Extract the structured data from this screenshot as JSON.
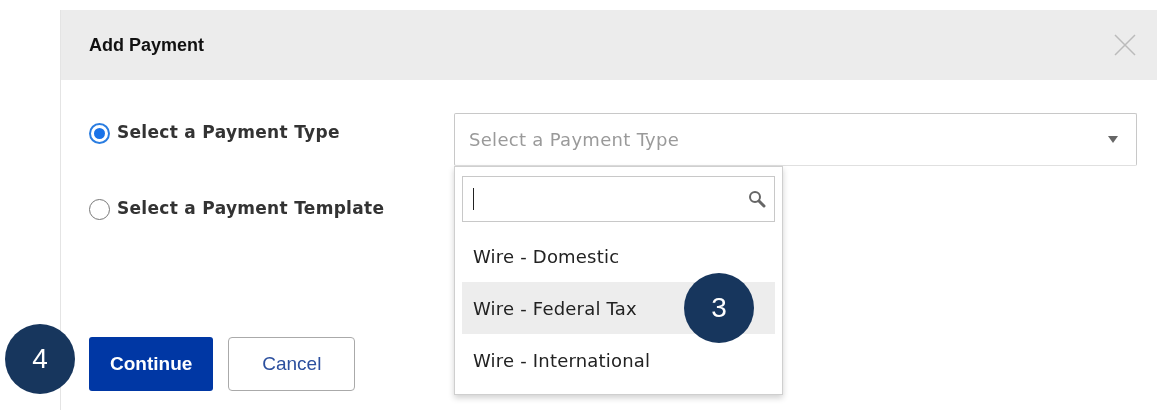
{
  "dialog": {
    "title": "Add Payment"
  },
  "options": [
    {
      "label": "Select a Payment Type",
      "selected": true
    },
    {
      "label": "Select a Payment Template",
      "selected": false
    }
  ],
  "select": {
    "placeholder": "Select a Payment Type",
    "expanded": true
  },
  "dropdown": {
    "items": [
      {
        "label": "Wire - Domestic",
        "selected": false
      },
      {
        "label": "Wire - Federal Tax",
        "selected": true,
        "callout": "3"
      },
      {
        "label": "Wire - International",
        "selected": false
      }
    ]
  },
  "buttons": [
    {
      "label": "Continue",
      "kind": "primary",
      "callout": "4"
    },
    {
      "label": "Cancel",
      "kind": "secondary"
    }
  ]
}
